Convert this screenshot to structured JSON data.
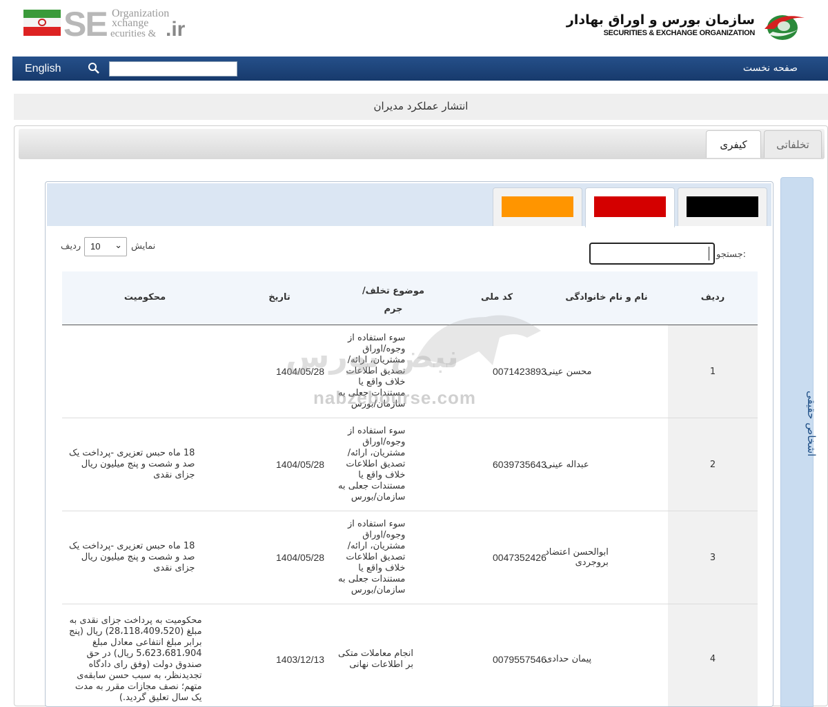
{
  "header": {
    "seo_letters": "SE",
    "seo_lines": [
      "Organization",
      "xchange",
      "ecurities &"
    ],
    "seo_ir": ".ir",
    "org_name_fa": "سازمان بورس و اوراق بهادار",
    "org_name_en": "SECURITIES & EXCHANGE ORGANIZATION"
  },
  "nav": {
    "english_label": "English",
    "search_placeholder": "",
    "home_label": "صفحه نخست"
  },
  "page_title": "انتشار عملکرد مدیران",
  "tabs": [
    {
      "label": "کیفری",
      "active": true
    },
    {
      "label": "تخلفاتی",
      "active": false
    }
  ],
  "side_tab_label": "اشخاص حقیقی",
  "color_tabs": [
    {
      "color": "#000000",
      "active": false
    },
    {
      "color": "#d40000",
      "active": true
    },
    {
      "color": "#ff9500",
      "active": false
    }
  ],
  "controls": {
    "show_label": "نمایش",
    "rows_label": "ردیف",
    "page_size": "10",
    "search_label": "جستجو:",
    "search_value": ""
  },
  "table": {
    "headers": {
      "index": "ردیف",
      "name": "نام و نام خانوادگی",
      "code": "کد ملی",
      "subject_line1": "موضوع تخلف/",
      "subject_line2": "جرم",
      "date": "تاریخ",
      "verdict": "محکومیت"
    },
    "rows": [
      {
        "index": "1",
        "name": [
          "محسن عینی"
        ],
        "code": "0071423893",
        "subject": [
          "سوء استفاده از",
          "وجوه/اوراق",
          "مشتریان، ارائه/",
          "تصدیق اطلاعات",
          "خلاف واقع یا",
          "مستندات جعلی به",
          "سازمان/بورس"
        ],
        "date": "1404/05/28",
        "verdict": []
      },
      {
        "index": "2",
        "name": [
          "عبداله عینی"
        ],
        "code": "6039735643",
        "subject": [
          "سوء استفاده از",
          "وجوه/اوراق",
          "مشتریان، ارائه/",
          "تصدیق اطلاعات",
          "خلاف واقع یا",
          "مستندات جعلی به",
          "سازمان/بورس"
        ],
        "date": "1404/05/28",
        "verdict": [
          "18 ماه حبس تعزیری -پرداخت یک",
          "صد و شصت و پنج میلیون ریال",
          "جزای نقدی"
        ]
      },
      {
        "index": "3",
        "name": [
          "ابوالحسن اعتضاد",
          "بروجردی"
        ],
        "code": "0047352426",
        "subject": [
          "سوء استفاده از",
          "وجوه/اوراق",
          "مشتریان، ارائه/",
          "تصدیق اطلاعات",
          "خلاف واقع یا",
          "مستندات جعلی به",
          "سازمان/بورس"
        ],
        "date": "1404/05/28",
        "verdict": [
          "18 ماه حبس تعزیری -پرداخت یک",
          "صد و شصت و پنج میلیون ریال",
          "جزای نقدی"
        ]
      },
      {
        "index": "4",
        "name": [
          "پیمان حدادی"
        ],
        "code": "0079557546",
        "subject": [
          "انجام معاملات متکی",
          "بر اطلاعات نهانی"
        ],
        "date": "1403/12/13",
        "verdict": [
          "محکومیت به پرداخت جزای نقدی به",
          "مبلغ (28،118،409،520) ریال (پنج",
          "برابر مبلغ انتفاعی معادل مبلغ",
          "5،623،681،904 ریال) در حق",
          "صندوق دولت (وفق رای دادگاه",
          "تجدیدنظر، به سبب حسن سابقه‌ی",
          "متهم؛ نصف مجازات مقرر به مدت",
          "یک سال تعلیق گردید.)"
        ]
      }
    ]
  },
  "watermark": {
    "text_fa": "نبض بورس",
    "text_en": "nabzebourse.com"
  }
}
